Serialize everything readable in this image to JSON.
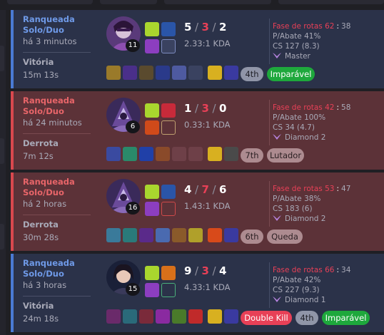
{
  "colors": {
    "win_bg": "#2b3249",
    "loss_bg": "#5c3238",
    "win_accent": "#6f9ae8",
    "loss_accent": "#e86569",
    "kda_death": "#e84057",
    "badge_green": "#1ea83c",
    "badge_red": "#e84057"
  },
  "matches": [
    {
      "outcome": "win",
      "mode": "Ranqueada Solo/Duo",
      "ago": "há 3 minutos",
      "result": "Vitória",
      "duration": "15m 13s",
      "champion_icon": "purple-masked-champion-portrait",
      "level": "11",
      "kills": "5",
      "deaths": "3",
      "assists": "2",
      "kda_ratio": "2.33:1 KDA",
      "placement": "4th",
      "tags": [
        {
          "label": "Imparável",
          "style": "green"
        }
      ],
      "stats": {
        "phase_label": "Fase de rotas",
        "phase_value": "62",
        "phase_other": "38",
        "kill_participation": "P/Abate 41%",
        "cs": "CS 127 (8.3)",
        "rank": "Master"
      }
    },
    {
      "outcome": "loss",
      "mode": "Ranqueada Solo/Duo",
      "ago": "há 24 minutos",
      "result": "Derrota",
      "duration": "7m 12s",
      "champion_icon": "hooded-assassin-champion-portrait",
      "level": "6",
      "kills": "1",
      "deaths": "3",
      "assists": "0",
      "kda_ratio": "0.33:1 KDA",
      "placement": "7th",
      "tags": [
        {
          "label": "Lutador",
          "style": "label"
        }
      ],
      "stats": {
        "phase_label": "Fase de rotas",
        "phase_value": "42",
        "phase_other": "58",
        "kill_participation": "P/Abate 100%",
        "cs": "CS 34 (4.7)",
        "rank": "Diamond 2"
      }
    },
    {
      "outcome": "loss",
      "mode": "Ranqueada Solo/Duo",
      "ago": "há 2 horas",
      "result": "Derrota",
      "duration": "30m 28s",
      "champion_icon": "hooded-assassin-champion-portrait",
      "level": "16",
      "kills": "4",
      "deaths": "7",
      "assists": "6",
      "kda_ratio": "1.43:1 KDA",
      "placement": "6th",
      "tags": [
        {
          "label": "Queda",
          "style": "label"
        }
      ],
      "stats": {
        "phase_label": "Fase de rotas",
        "phase_value": "53",
        "phase_other": "47",
        "kill_participation": "P/Abate 38%",
        "cs": "CS 183 (6)",
        "rank": "Diamond 2"
      }
    },
    {
      "outcome": "win",
      "mode": "Ranqueada Solo/Duo",
      "ago": "há 3 horas",
      "result": "Vitória",
      "duration": "24m 18s",
      "champion_icon": "dark-haired-champion-portrait",
      "level": "15",
      "kills": "9",
      "deaths": "3",
      "assists": "4",
      "kda_ratio": "4.33:1 KDA",
      "placement": "4th",
      "tags": [
        {
          "label": "Double Kill",
          "style": "red"
        },
        {
          "label": "Imparável",
          "style": "green"
        }
      ],
      "stats": {
        "phase_label": "Fase de rotas",
        "phase_value": "66",
        "phase_other": "34",
        "kill_participation": "P/Abate 42%",
        "cs": "CS 227 (9.3)",
        "rank": "Diamond 1"
      }
    }
  ]
}
